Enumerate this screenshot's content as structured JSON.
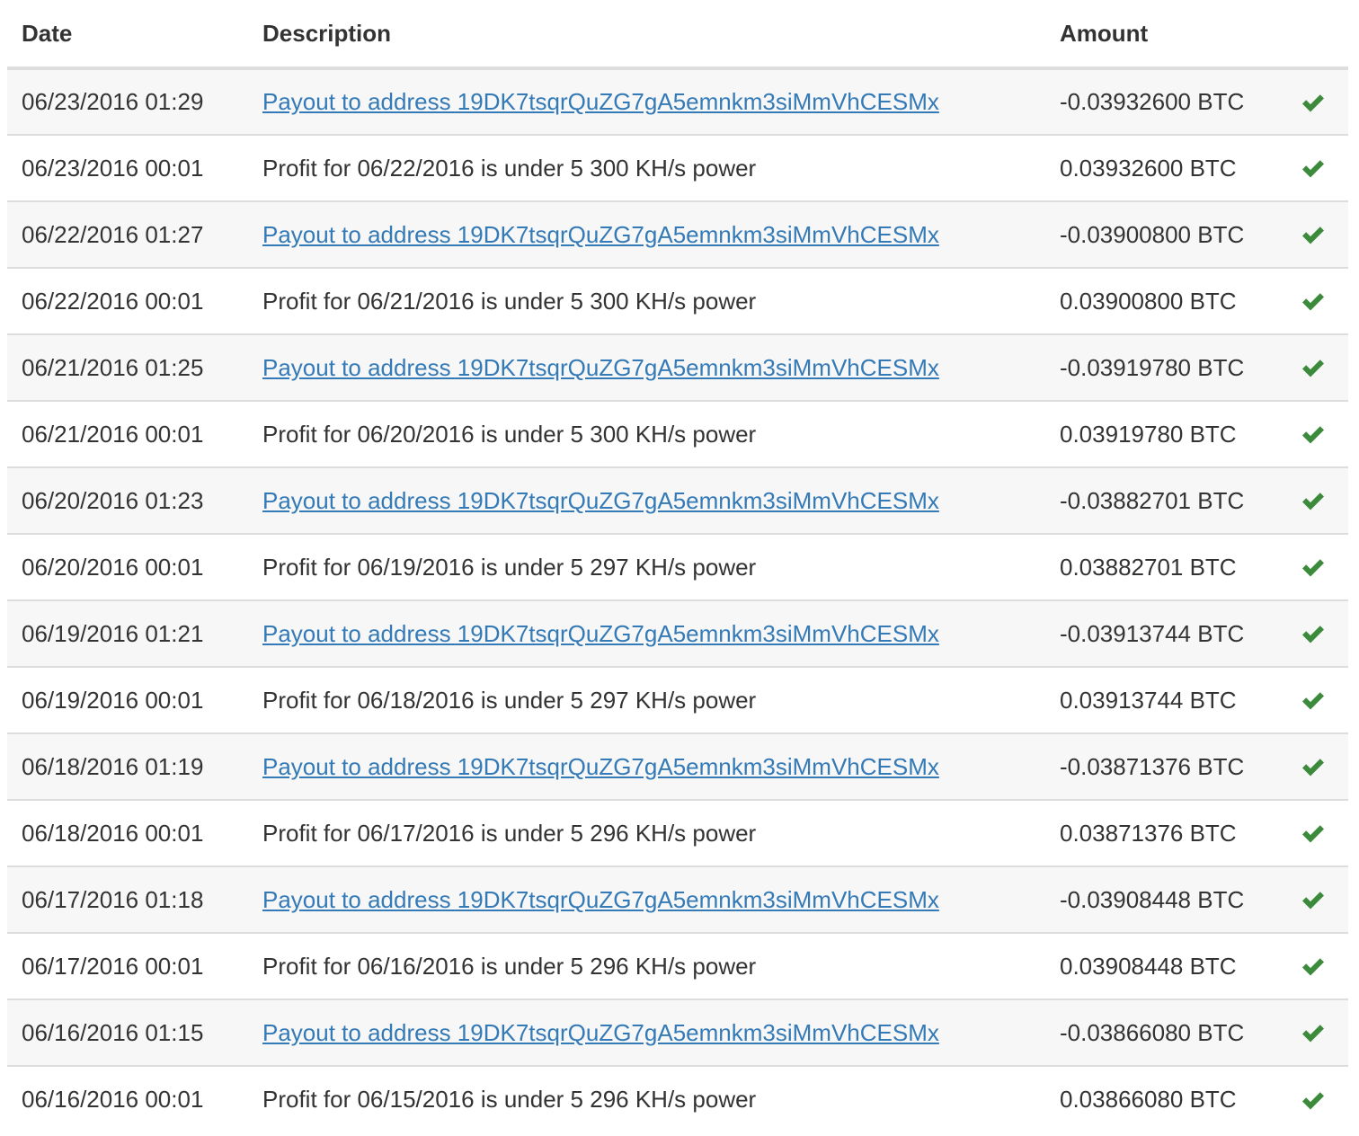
{
  "columns": {
    "date": "Date",
    "description": "Description",
    "amount": "Amount"
  },
  "colors": {
    "link": "#337ab7",
    "check": "#3c8a3c",
    "stripe": "#f7f7f7",
    "border": "#dddddd"
  },
  "rows": [
    {
      "date": "06/23/2016 01:29",
      "description": "Payout to address 19DK7tsqrQuZG7gA5emnkm3siMmVhCESMx",
      "is_link": true,
      "amount": "-0.03932600 BTC",
      "status_icon": "check-icon"
    },
    {
      "date": "06/23/2016 00:01",
      "description": "Profit for 06/22/2016 is under 5 300 KH/s power",
      "is_link": false,
      "amount": "0.03932600 BTC",
      "status_icon": "check-icon"
    },
    {
      "date": "06/22/2016 01:27",
      "description": "Payout to address 19DK7tsqrQuZG7gA5emnkm3siMmVhCESMx",
      "is_link": true,
      "amount": "-0.03900800 BTC",
      "status_icon": "check-icon"
    },
    {
      "date": "06/22/2016 00:01",
      "description": "Profit for 06/21/2016 is under 5 300 KH/s power",
      "is_link": false,
      "amount": "0.03900800 BTC",
      "status_icon": "check-icon"
    },
    {
      "date": "06/21/2016 01:25",
      "description": "Payout to address 19DK7tsqrQuZG7gA5emnkm3siMmVhCESMx",
      "is_link": true,
      "amount": "-0.03919780 BTC",
      "status_icon": "check-icon"
    },
    {
      "date": "06/21/2016 00:01",
      "description": "Profit for 06/20/2016 is under 5 300 KH/s power",
      "is_link": false,
      "amount": "0.03919780 BTC",
      "status_icon": "check-icon"
    },
    {
      "date": "06/20/2016 01:23",
      "description": "Payout to address 19DK7tsqrQuZG7gA5emnkm3siMmVhCESMx",
      "is_link": true,
      "amount": "-0.03882701 BTC",
      "status_icon": "check-icon"
    },
    {
      "date": "06/20/2016 00:01",
      "description": "Profit for 06/19/2016 is under 5 297 KH/s power",
      "is_link": false,
      "amount": "0.03882701 BTC",
      "status_icon": "check-icon"
    },
    {
      "date": "06/19/2016 01:21",
      "description": "Payout to address 19DK7tsqrQuZG7gA5emnkm3siMmVhCESMx",
      "is_link": true,
      "amount": "-0.03913744 BTC",
      "status_icon": "check-icon"
    },
    {
      "date": "06/19/2016 00:01",
      "description": "Profit for 06/18/2016 is under 5 297 KH/s power",
      "is_link": false,
      "amount": "0.03913744 BTC",
      "status_icon": "check-icon"
    },
    {
      "date": "06/18/2016 01:19",
      "description": "Payout to address 19DK7tsqrQuZG7gA5emnkm3siMmVhCESMx",
      "is_link": true,
      "amount": "-0.03871376 BTC",
      "status_icon": "check-icon"
    },
    {
      "date": "06/18/2016 00:01",
      "description": "Profit for 06/17/2016 is under 5 296 KH/s power",
      "is_link": false,
      "amount": "0.03871376 BTC",
      "status_icon": "check-icon"
    },
    {
      "date": "06/17/2016 01:18",
      "description": "Payout to address 19DK7tsqrQuZG7gA5emnkm3siMmVhCESMx",
      "is_link": true,
      "amount": "-0.03908448 BTC",
      "status_icon": "check-icon"
    },
    {
      "date": "06/17/2016 00:01",
      "description": "Profit for 06/16/2016 is under 5 296 KH/s power",
      "is_link": false,
      "amount": "0.03908448 BTC",
      "status_icon": "check-icon"
    },
    {
      "date": "06/16/2016 01:15",
      "description": "Payout to address 19DK7tsqrQuZG7gA5emnkm3siMmVhCESMx",
      "is_link": true,
      "amount": "-0.03866080 BTC",
      "status_icon": "check-icon"
    },
    {
      "date": "06/16/2016 00:01",
      "description": "Profit for 06/15/2016 is under 5 296 KH/s power",
      "is_link": false,
      "amount": "0.03866080 BTC",
      "status_icon": "check-icon"
    }
  ]
}
